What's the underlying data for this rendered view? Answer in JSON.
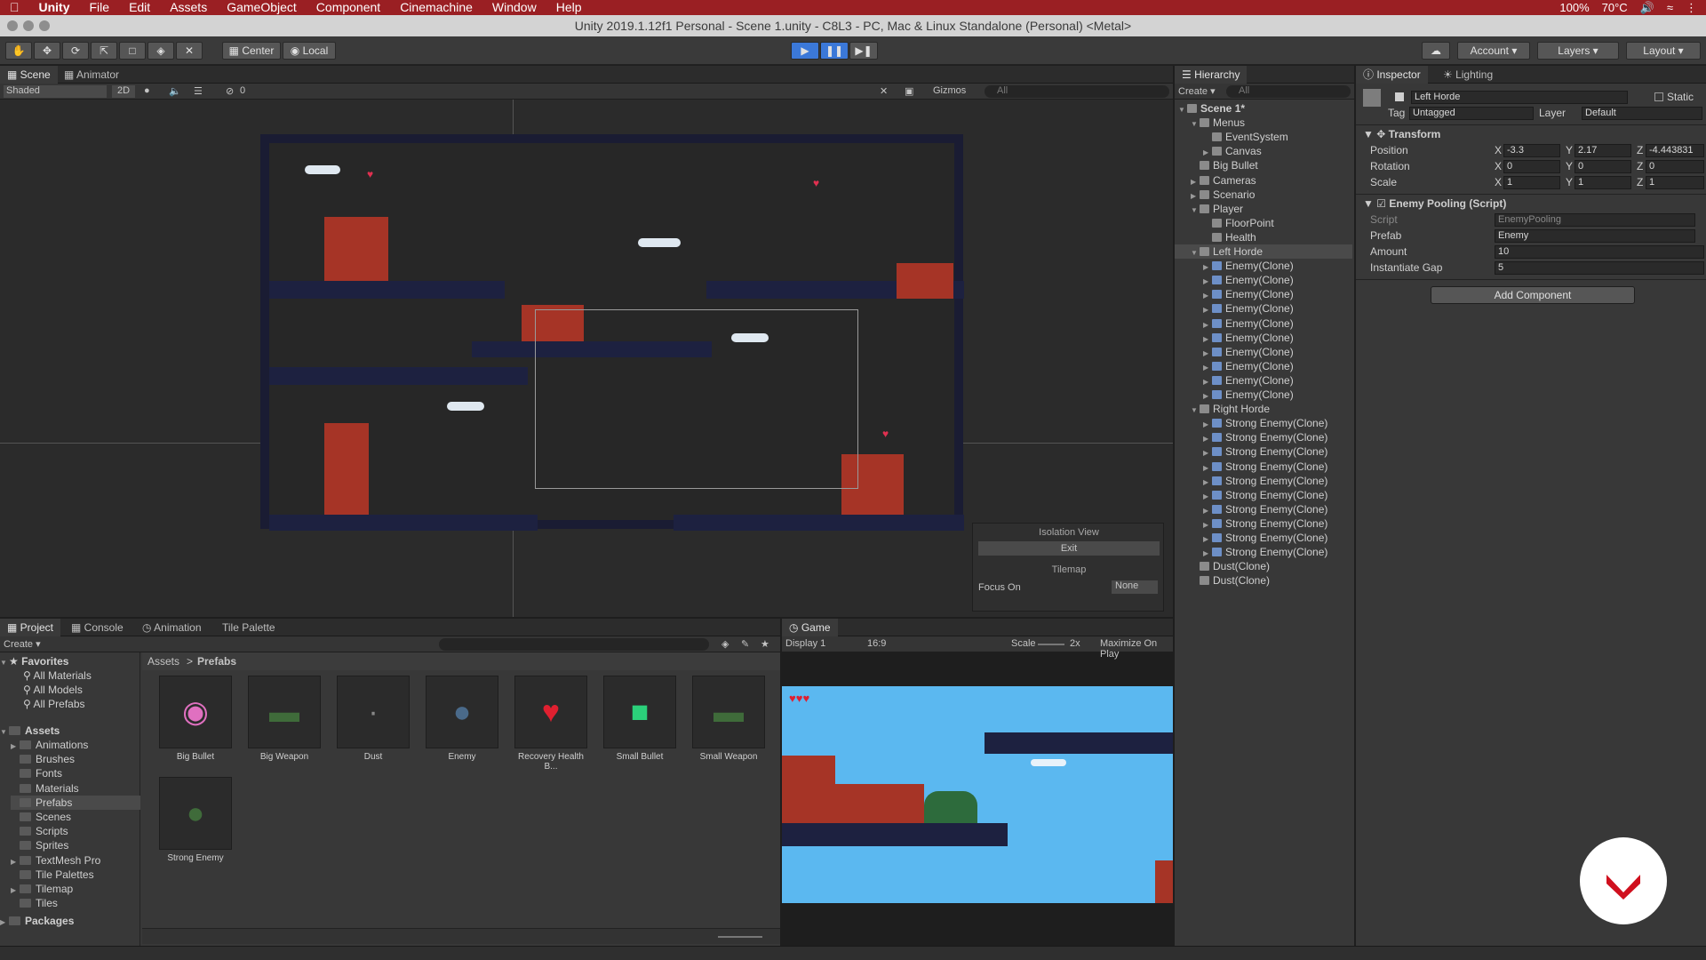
{
  "menubar": {
    "app": "Unity",
    "items": [
      "File",
      "Edit",
      "Assets",
      "GameObject",
      "Component",
      "Cinemachine",
      "Window",
      "Help"
    ],
    "status": {
      "battery": "100%",
      "temp": "70°C"
    }
  },
  "window": {
    "title": "Unity 2019.1.12f1 Personal - Scene 1.unity - C8L3 - PC, Mac & Linux Standalone (Personal) <Metal>"
  },
  "toolbar": {
    "center": "Center",
    "local": "Local",
    "account": "Account",
    "layers": "Layers",
    "layout": "Layout"
  },
  "scene": {
    "tabs": [
      "Scene",
      "Animator"
    ],
    "shading": "Shaded",
    "mode2d": "2D",
    "gizmos": "Gizmos",
    "search_placeholder": "All",
    "fx_count": "0",
    "isolation": {
      "title": "Isolation View",
      "exit": "Exit",
      "tilemap": "Tilemap",
      "focus_label": "Focus On",
      "focus_value": "None"
    }
  },
  "hierarchy": {
    "tab": "Hierarchy",
    "create": "Create",
    "search_placeholder": "All",
    "rows": [
      {
        "t": "Scene 1*",
        "d": 0,
        "a": "▼",
        "bold": true
      },
      {
        "t": "Menus",
        "d": 1,
        "a": "▼"
      },
      {
        "t": "EventSystem",
        "d": 2,
        "a": ""
      },
      {
        "t": "Canvas",
        "d": 2,
        "a": "▶"
      },
      {
        "t": "Big Bullet",
        "d": 1,
        "a": ""
      },
      {
        "t": "Cameras",
        "d": 1,
        "a": "▶"
      },
      {
        "t": "Scenario",
        "d": 1,
        "a": "▶"
      },
      {
        "t": "Player",
        "d": 1,
        "a": "▼"
      },
      {
        "t": "FloorPoint",
        "d": 2,
        "a": ""
      },
      {
        "t": "Health",
        "d": 2,
        "a": ""
      },
      {
        "t": "Left Horde",
        "d": 1,
        "a": "▼",
        "sel": true
      },
      {
        "t": "Enemy(Clone)",
        "d": 2,
        "a": "▶",
        "p": true
      },
      {
        "t": "Enemy(Clone)",
        "d": 2,
        "a": "▶",
        "p": true
      },
      {
        "t": "Enemy(Clone)",
        "d": 2,
        "a": "▶",
        "p": true
      },
      {
        "t": "Enemy(Clone)",
        "d": 2,
        "a": "▶",
        "p": true
      },
      {
        "t": "Enemy(Clone)",
        "d": 2,
        "a": "▶",
        "p": true
      },
      {
        "t": "Enemy(Clone)",
        "d": 2,
        "a": "▶",
        "p": true
      },
      {
        "t": "Enemy(Clone)",
        "d": 2,
        "a": "▶",
        "p": true
      },
      {
        "t": "Enemy(Clone)",
        "d": 2,
        "a": "▶",
        "p": true
      },
      {
        "t": "Enemy(Clone)",
        "d": 2,
        "a": "▶",
        "p": true
      },
      {
        "t": "Enemy(Clone)",
        "d": 2,
        "a": "▶",
        "p": true
      },
      {
        "t": "Right Horde",
        "d": 1,
        "a": "▼"
      },
      {
        "t": "Strong Enemy(Clone)",
        "d": 2,
        "a": "▶",
        "p": true
      },
      {
        "t": "Strong Enemy(Clone)",
        "d": 2,
        "a": "▶",
        "p": true
      },
      {
        "t": "Strong Enemy(Clone)",
        "d": 2,
        "a": "▶",
        "p": true
      },
      {
        "t": "Strong Enemy(Clone)",
        "d": 2,
        "a": "▶",
        "p": true
      },
      {
        "t": "Strong Enemy(Clone)",
        "d": 2,
        "a": "▶",
        "p": true
      },
      {
        "t": "Strong Enemy(Clone)",
        "d": 2,
        "a": "▶",
        "p": true
      },
      {
        "t": "Strong Enemy(Clone)",
        "d": 2,
        "a": "▶",
        "p": true
      },
      {
        "t": "Strong Enemy(Clone)",
        "d": 2,
        "a": "▶",
        "p": true
      },
      {
        "t": "Strong Enemy(Clone)",
        "d": 2,
        "a": "▶",
        "p": true
      },
      {
        "t": "Strong Enemy(Clone)",
        "d": 2,
        "a": "▶",
        "p": true
      },
      {
        "t": "Dust(Clone)",
        "d": 1,
        "a": ""
      },
      {
        "t": "Dust(Clone)",
        "d": 1,
        "a": ""
      }
    ]
  },
  "inspector": {
    "tab": "Inspector",
    "lighting": "Lighting",
    "object_name": "Left Horde",
    "static": "Static",
    "tag_label": "Tag",
    "tag": "Untagged",
    "layer_label": "Layer",
    "layer": "Default",
    "transform": {
      "title": "Transform",
      "position": {
        "label": "Position",
        "x": "-3.3",
        "y": "2.17",
        "z": "-4.443831"
      },
      "rotation": {
        "label": "Rotation",
        "x": "0",
        "y": "0",
        "z": "0"
      },
      "scale": {
        "label": "Scale",
        "x": "1",
        "y": "1",
        "z": "1"
      }
    },
    "script_comp": {
      "title": "Enemy Pooling (Script)",
      "script_label": "Script",
      "script": "EnemyPooling",
      "prefab_label": "Prefab",
      "prefab": "Enemy",
      "amount_label": "Amount",
      "amount": "10",
      "gap_label": "Instantiate Gap",
      "gap": "5"
    },
    "add_component": "Add Component"
  },
  "project": {
    "tabs": [
      "Project",
      "Console",
      "Animation",
      "Tile Palette"
    ],
    "create": "Create",
    "breadcrumb": [
      "Assets",
      "Prefabs"
    ],
    "favorites": "Favorites",
    "fav_items": [
      "All Materials",
      "All Models",
      "All Prefabs"
    ],
    "assets": "Assets",
    "asset_folders": [
      {
        "n": "Animations",
        "a": "▶"
      },
      {
        "n": "Brushes",
        "a": ""
      },
      {
        "n": "Fonts",
        "a": ""
      },
      {
        "n": "Materials",
        "a": ""
      },
      {
        "n": "Prefabs",
        "a": "",
        "sel": true
      },
      {
        "n": "Scenes",
        "a": ""
      },
      {
        "n": "Scripts",
        "a": ""
      },
      {
        "n": "Sprites",
        "a": ""
      },
      {
        "n": "TextMesh Pro",
        "a": "▶"
      },
      {
        "n": "Tile Palettes",
        "a": ""
      },
      {
        "n": "Tilemap",
        "a": "▶"
      },
      {
        "n": "Tiles",
        "a": ""
      }
    ],
    "packages": "Packages",
    "prefabs": [
      "Big Bullet",
      "Big Weapon",
      "Dust",
      "Enemy",
      "Recovery Health B...",
      "Small Bullet",
      "Small Weapon",
      "Strong Enemy"
    ]
  },
  "game": {
    "tab": "Game",
    "display": "Display 1",
    "aspect": "16:9",
    "scale_label": "Scale",
    "scale": "2x",
    "maximize": "Maximize On Play"
  }
}
